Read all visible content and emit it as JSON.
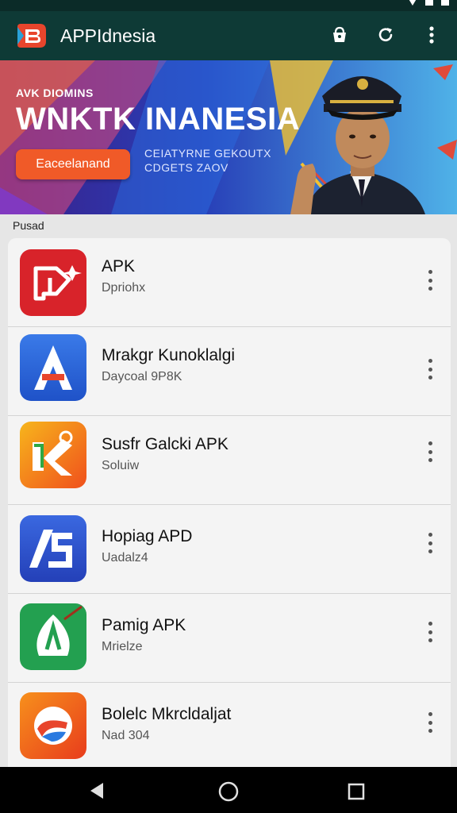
{
  "app": {
    "title": "APPIdnesia"
  },
  "banner": {
    "small_text": "AVK DIOMINS",
    "headline": "WNKTK INANESIA",
    "cta_label": "Eaceelanand",
    "sub_line1": "CEIATYRNE GEKOUTX",
    "sub_line2": "CDGETS ZAOV"
  },
  "section_label": "Pusad",
  "apps": [
    {
      "title": "APK",
      "subtitle": "Dpriohx"
    },
    {
      "title": "Mrakgr Kunoklalgi",
      "subtitle": "Daycoal 9P8K"
    },
    {
      "title": "Susfr Galcki APK",
      "subtitle": "Soluiw"
    },
    {
      "title": "Hopiag APD",
      "subtitle": "Uadalz4"
    },
    {
      "title": "Pamig APK",
      "subtitle": "Mrielze"
    },
    {
      "title": "Bolelc Mkrcldaljat",
      "subtitle": "Nad 304"
    }
  ],
  "colors": {
    "app_bar": "#0e3a36",
    "accent": "#f05a28"
  }
}
